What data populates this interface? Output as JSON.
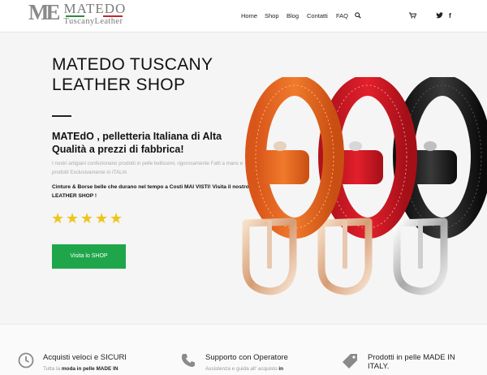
{
  "header": {
    "logo_mark": "ME",
    "logo_title": "MATEDO",
    "logo_sub": "TuscanyLeather",
    "nav": [
      "Home",
      "Shop",
      "Blog",
      "Contatti",
      "FAQ"
    ]
  },
  "icons": {
    "search": "search-icon",
    "cart": "cart-icon",
    "twitter": "twitter-icon",
    "facebook": "facebook-icon",
    "clock": "clock-icon",
    "phone": "phone-icon",
    "tag": "tag-icon"
  },
  "hero": {
    "title": "MATEDO TUSCANY LEATHER SHOP",
    "subtitle": "MATEdO , pelletteria Italiana di Alta Qualità a prezzi di fabbrica!",
    "desc": "I nostri artigiani confezionano prodotti in pelle bellissimi, rigorosamente Fatti a mano e prodotti Esclusivamente in ITALIA",
    "desc2": "Cinture & Borse belle che durano nel tempo a Costi MAI VISTI! Visita il nostro LEATHER SHOP !",
    "rating": 5,
    "button": "Visita lo SHOP",
    "colors": {
      "button": "#1fa64a",
      "stars": "#f0c419"
    }
  },
  "features": [
    {
      "title": "Acquisti veloci e SICURI",
      "text_plain": "Tutta la ",
      "text_bold": "moda in pelle MADE IN"
    },
    {
      "title": "Supporto con Operatore",
      "text_plain": "Assistenza e guida all' acquisto ",
      "text_bold": "in"
    },
    {
      "title": "Prodotti in pelle MADE IN ITALY.",
      "text_plain": "",
      "text_bold": ""
    }
  ]
}
